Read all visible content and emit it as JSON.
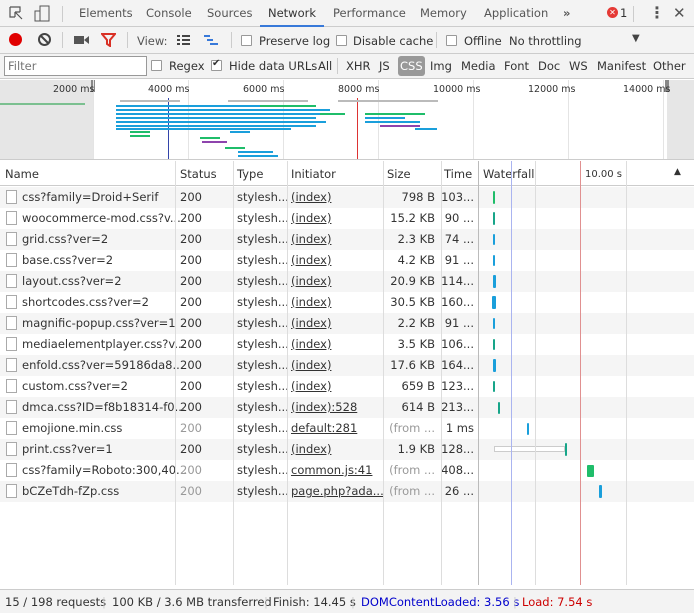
{
  "tabs": [
    "Elements",
    "Console",
    "Sources",
    "Network",
    "Performance",
    "Memory",
    "Application"
  ],
  "active_tab": "Network",
  "more_tabs": "»",
  "error_count": "1",
  "toolbar": {
    "view_label": "View:",
    "preserve_log": "Preserve log",
    "preserve_log_checked": false,
    "disable_cache": "Disable cache",
    "disable_cache_checked": false,
    "offline": "Offline",
    "offline_checked": false,
    "throttling": "No throttling"
  },
  "filter": {
    "placeholder": "Filter",
    "value": "",
    "regex": "Regex",
    "regex_checked": false,
    "hide_data_urls": "Hide data URLs",
    "hide_data_urls_checked": true,
    "types": [
      "All",
      "XHR",
      "JS",
      "CSS",
      "Img",
      "Media",
      "Font",
      "Doc",
      "WS",
      "Manifest",
      "Other"
    ],
    "active_type": "CSS"
  },
  "overview": {
    "ticks": [
      "2000 ms",
      "4000 ms",
      "6000 ms",
      "8000 ms",
      "10000 ms",
      "12000 ms",
      "14000 ms"
    ]
  },
  "columns": {
    "name": "Name",
    "status": "Status",
    "type": "Type",
    "initiator": "Initiator",
    "size": "Size",
    "time": "Time",
    "waterfall": "Waterfall",
    "waterfall_tick": "10.00 s"
  },
  "rows": [
    {
      "name": "css?family=Droid+Serif",
      "status": "200",
      "type": "stylesh...",
      "initiator": "(index)",
      "size": "798 B",
      "time": "103..."
    },
    {
      "name": "woocommerce-mod.css?v...",
      "status": "200",
      "type": "stylesh...",
      "initiator": "(index)",
      "size": "15.2 KB",
      "time": "90 ..."
    },
    {
      "name": "grid.css?ver=2",
      "status": "200",
      "type": "stylesh...",
      "initiator": "(index)",
      "size": "2.3 KB",
      "time": "74 ..."
    },
    {
      "name": "base.css?ver=2",
      "status": "200",
      "type": "stylesh...",
      "initiator": "(index)",
      "size": "4.2 KB",
      "time": "91 ..."
    },
    {
      "name": "layout.css?ver=2",
      "status": "200",
      "type": "stylesh...",
      "initiator": "(index)",
      "size": "20.9 KB",
      "time": "114..."
    },
    {
      "name": "shortcodes.css?ver=2",
      "status": "200",
      "type": "stylesh...",
      "initiator": "(index)",
      "size": "30.5 KB",
      "time": "160..."
    },
    {
      "name": "magnific-popup.css?ver=1",
      "status": "200",
      "type": "stylesh...",
      "initiator": "(index)",
      "size": "2.2 KB",
      "time": "91 ..."
    },
    {
      "name": "mediaelementplayer.css?v...",
      "status": "200",
      "type": "stylesh...",
      "initiator": "(index)",
      "size": "3.5 KB",
      "time": "106..."
    },
    {
      "name": "enfold.css?ver=59186da8...",
      "status": "200",
      "type": "stylesh...",
      "initiator": "(index)",
      "size": "17.6 KB",
      "time": "164..."
    },
    {
      "name": "custom.css?ver=2",
      "status": "200",
      "type": "stylesh...",
      "initiator": "(index)",
      "size": "659 B",
      "time": "123..."
    },
    {
      "name": "dmca.css?ID=f8b18314-f0...",
      "status": "200",
      "type": "stylesh...",
      "initiator": "(index):528",
      "size": "614 B",
      "time": "213..."
    },
    {
      "name": "emojione.min.css",
      "status": "200",
      "type": "stylesh...",
      "initiator": "default:281",
      "size": "(from ...",
      "time": "1 ms",
      "cached": true
    },
    {
      "name": "print.css?ver=1",
      "status": "200",
      "type": "stylesh...",
      "initiator": "(index)",
      "size": "1.9 KB",
      "time": "128..."
    },
    {
      "name": "css?family=Roboto:300,40...",
      "status": "200",
      "type": "stylesh...",
      "initiator": "common.js:41",
      "size": "(from ...",
      "time": "408...",
      "cached": true
    },
    {
      "name": "bCZeTdh-fZp.css",
      "status": "200",
      "type": "stylesh...",
      "initiator": "page.php?ada...",
      "size": "(from ...",
      "time": "26 ...",
      "cached": true
    }
  ],
  "status_bar": {
    "requests": "15 / 198 requests",
    "transferred": "100 KB / 3.6 MB transferred",
    "finish": "Finish: 14.45 s",
    "dom_content_loaded": "DOMContentLoaded: 3.56 s",
    "load": "Load: 7.54 s"
  },
  "colors": {
    "accent": "#3879d9",
    "record": "#e00000",
    "filter_icon": "#d93025",
    "dcl": "#0000cc",
    "load": "#cc0000",
    "bar_blue": "#1a9fdb",
    "bar_green": "#1fbd6a"
  }
}
